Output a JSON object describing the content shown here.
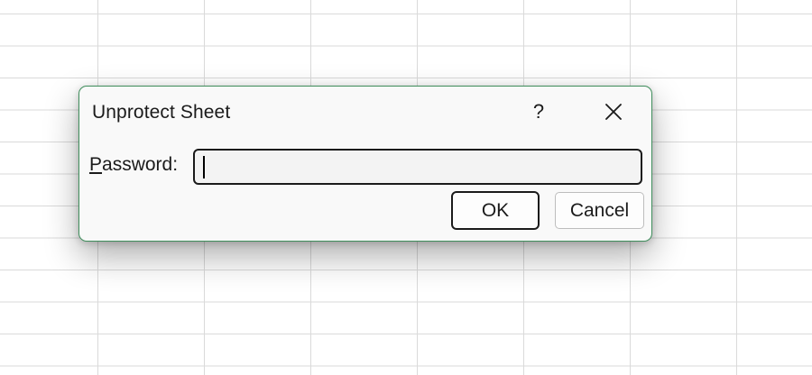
{
  "dialog": {
    "title": "Unprotect Sheet",
    "help_label": "?",
    "close_icon": "close-icon",
    "password_label_accel": "P",
    "password_label_rest": "assword:",
    "password_value": "",
    "ok_label": "OK",
    "cancel_label": "Cancel",
    "border_color": "#3f8e5c"
  }
}
